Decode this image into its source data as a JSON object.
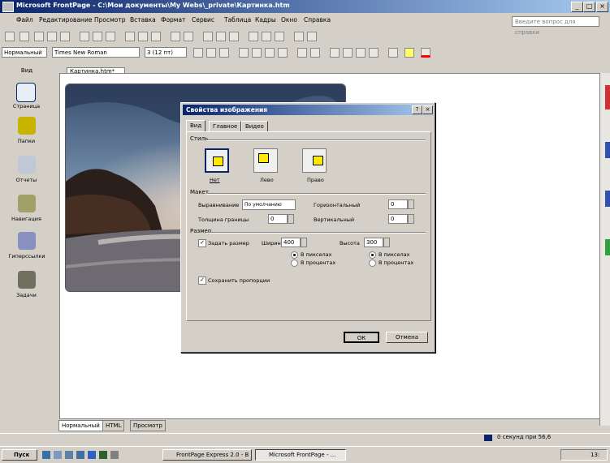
{
  "window": {
    "title": "Microsoft FrontPage - C:\\Мои документы\\My Webs\\_private\\Картинка.htm",
    "min": "_",
    "max": "□",
    "close": "×"
  },
  "menu": [
    "Файл",
    "Редактирование",
    "Просмотр",
    "Вставка",
    "Формат",
    "Сервис",
    "Таблица",
    "Кадры",
    "Окно",
    "Справка"
  ],
  "help_placeholder": "Введите вопрос для справки",
  "format_bar": {
    "style": "Нормальный",
    "font": "Times New Roman",
    "size": "3 (12 пт)"
  },
  "views_title": "Вид",
  "views": [
    {
      "label": "Страница",
      "icon": "page-icon"
    },
    {
      "label": "Папки",
      "icon": "folders-icon"
    },
    {
      "label": "Отчеты",
      "icon": "reports-icon"
    },
    {
      "label": "Навигация",
      "icon": "navigation-icon"
    },
    {
      "label": "Гиперссылки",
      "icon": "hyperlinks-icon"
    },
    {
      "label": "Задачи",
      "icon": "tasks-icon"
    }
  ],
  "doc_tab": "Картинка.htm*",
  "bottom_tabs": [
    "Нормальный",
    "HTML",
    "Просмотр"
  ],
  "status": {
    "time": "0 секунд при 56,6"
  },
  "taskbar": {
    "start": "Пуск",
    "tasks": [
      "FrontPage Express 2.0 - В",
      "Microsoft FrontPage - ..."
    ],
    "clock": "13:"
  },
  "dialog": {
    "title": "Свойства изображения",
    "help": "?",
    "close": "×",
    "tabs": [
      "Вид",
      "Главное",
      "Видео"
    ],
    "wrap_label": "Стиль",
    "wrap_options": [
      "Нет",
      "Лево",
      "Право"
    ],
    "layout_label": "Макет",
    "alignment_label": "Выравнивание",
    "alignment_value": "По умолчанию",
    "border_label": "Толщина границы",
    "border_value": "0",
    "horizontal_label": "Горизонтальный",
    "horizontal_value": "0",
    "vertical_label": "Вертикальный",
    "vertical_value": "0",
    "size_label": "Размер",
    "specify_size": "Задать размер",
    "width_label": "Ширина",
    "width_value": "400",
    "height_label": "Высота",
    "height_value": "300",
    "pixels": "В пикселах",
    "percent": "В процентах",
    "keep_ratio": "Сохранить пропорции",
    "ok": "ОК",
    "cancel": "Отмена"
  }
}
